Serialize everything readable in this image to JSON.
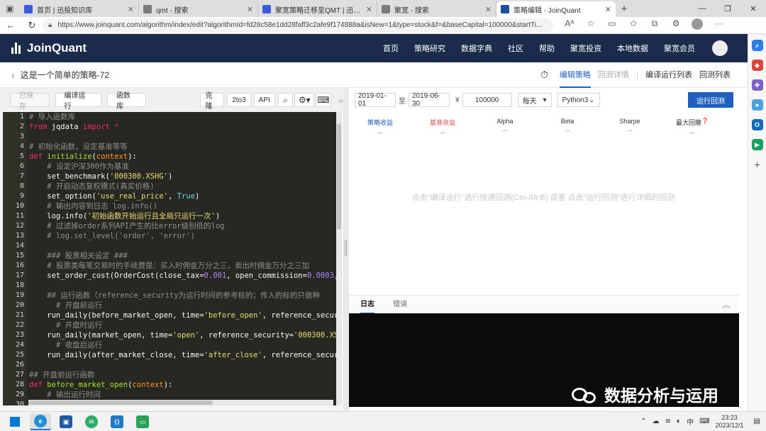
{
  "browser": {
    "tabs": [
      {
        "title": "首页 | 迅投知识库",
        "icon_color": "#3b5bdb",
        "active": false
      },
      {
        "title": "qmt - 搜索",
        "icon_color": "#7a7a7a",
        "active": false
      },
      {
        "title": "聚宽策略迁移至QMT | 迅投知识库",
        "icon_color": "#3b5bdb",
        "active": false
      },
      {
        "title": "聚宽 - 搜索",
        "icon_color": "#7a7a7a",
        "active": false
      },
      {
        "title": "策略编辑 - JoinQuant",
        "icon_color": "#1a4fa3",
        "active": true
      }
    ],
    "url": "https://www.joinquant.com/algorithm/index/edit?algorithmId=fd28c58e1dd28faff3c2afe9f174888a&isNew=1&type=stock&f=&baseCapital=100000&startTi..."
  },
  "site": {
    "logo": "JoinQuant",
    "nav": [
      "首页",
      "策略研究",
      "数据字典",
      "社区",
      "帮助",
      "聚宽投资",
      "本地数据",
      "聚宽会员"
    ]
  },
  "strategy": {
    "title": "这是一个简单的策略-72",
    "tabs": [
      {
        "label": "编辑策略",
        "state": "on"
      },
      {
        "label": "回测详情",
        "state": "dim"
      },
      {
        "label": "编译运行列表",
        "state": "normal"
      },
      {
        "label": "回测列表",
        "state": "normal"
      }
    ]
  },
  "editor": {
    "toolbar": {
      "saved": "已保存",
      "compile": "编译运行",
      "library": "函数库",
      "clone": "克隆",
      "to3": "2to3",
      "api": "API"
    },
    "lines": [
      [
        [
          "cm",
          "# 导入函数库"
        ]
      ],
      [
        [
          "kw",
          "from"
        ],
        [
          "",
          " jqdata "
        ],
        [
          "kw",
          "import"
        ],
        [
          "",
          " "
        ],
        [
          "kw",
          "*"
        ]
      ],
      [],
      [
        [
          "cm",
          "# 初始化函数，设定基准等等"
        ]
      ],
      [
        [
          "kw",
          "def"
        ],
        [
          "",
          " "
        ],
        [
          "fn",
          "initialize"
        ],
        [
          "",
          "("
        ],
        [
          "pa",
          "context"
        ],
        [
          "",
          "):"
        ]
      ],
      [
        [
          "",
          "    "
        ],
        [
          "cm",
          "# 设定沪深300作为基准"
        ]
      ],
      [
        [
          "",
          "    set_benchmark("
        ],
        [
          "st2",
          "'000300.XSHG'"
        ],
        [
          "",
          ")"
        ]
      ],
      [
        [
          "",
          "    "
        ],
        [
          "cm",
          "# 开启动态复权模式(真实价格)"
        ]
      ],
      [
        [
          "",
          "    set_option("
        ],
        [
          "st2",
          "'use_real_price'"
        ],
        [
          "",
          ", "
        ],
        [
          "bi",
          "True"
        ],
        [
          "",
          ")"
        ]
      ],
      [
        [
          "",
          "    "
        ],
        [
          "cm",
          "# 输出内容到日志 log.info()"
        ]
      ],
      [
        [
          "",
          "    log.info("
        ],
        [
          "st2",
          "'初始函数开始运行且全局只运行一次'"
        ],
        [
          "",
          ")"
        ]
      ],
      [
        [
          "",
          "    "
        ],
        [
          "cm",
          "# 过滤掉order系列API产生的比error级别低的log"
        ]
      ],
      [
        [
          "",
          "    "
        ],
        [
          "cm",
          "# log.set_level('order', 'error')"
        ]
      ],
      [],
      [
        [
          "",
          "    "
        ],
        [
          "cm",
          "### 股票相关设定 ###"
        ]
      ],
      [
        [
          "",
          "    "
        ],
        [
          "cm",
          "# 股票类每笔交易时的手续费是：买入时佣金万分之三，卖出时佣金万分之三加"
        ]
      ],
      [
        [
          "",
          "    set_order_cost(OrderCost(close_tax="
        ],
        [
          "nm",
          "0.001"
        ],
        [
          "",
          ", open_commission="
        ],
        [
          "nm",
          "0.0003"
        ],
        [
          "",
          ", clo"
        ]
      ],
      [],
      [
        [
          "",
          "    "
        ],
        [
          "cm",
          "## 运行函数（reference_security为运行时间的参考标的；传入的标的只做种"
        ]
      ],
      [
        [
          "",
          "      "
        ],
        [
          "cm",
          "# 开盘前运行"
        ]
      ],
      [
        [
          "",
          "    run_daily(before_market_open, time="
        ],
        [
          "st2",
          "'before_open'"
        ],
        [
          "",
          ", reference_security="
        ]
      ],
      [
        [
          "",
          "      "
        ],
        [
          "cm",
          "# 开盘时运行"
        ]
      ],
      [
        [
          "",
          "    run_daily(market_open, time="
        ],
        [
          "st2",
          "'open'"
        ],
        [
          "",
          ", reference_security="
        ],
        [
          "st2",
          "'000300.XSHG'"
        ],
        [
          "",
          ")"
        ]
      ],
      [
        [
          "",
          "      "
        ],
        [
          "cm",
          "# 收盘后运行"
        ]
      ],
      [
        [
          "",
          "    run_daily(after_market_close, time="
        ],
        [
          "st2",
          "'after_close'"
        ],
        [
          "",
          ", reference_security="
        ]
      ],
      [],
      [
        [
          "cm",
          "## 开盘前运行函数"
        ]
      ],
      [
        [
          "kw",
          "def"
        ],
        [
          "",
          " "
        ],
        [
          "fn",
          "before_market_open"
        ],
        [
          "",
          "("
        ],
        [
          "pa",
          "context"
        ],
        [
          "",
          "):"
        ]
      ],
      [
        [
          "",
          "    "
        ],
        [
          "cm",
          "# 输出运行时间"
        ]
      ],
      []
    ]
  },
  "backtest": {
    "start_date": "2019-01-01",
    "to_label": "至",
    "end_date": "2019-06-30",
    "currency": "¥",
    "capital": "100000",
    "frequency": "每天",
    "python": "Python3",
    "run_button": "运行回测",
    "metrics": [
      {
        "name": "策略收益",
        "value": "--",
        "color": "#1f5fbf"
      },
      {
        "name": "基准收益",
        "value": "--",
        "color": "#d9534f"
      },
      {
        "name": "Alpha",
        "value": "--",
        "color": "#333333"
      },
      {
        "name": "Beta",
        "value": "--",
        "color": "#333333"
      },
      {
        "name": "Sharpe",
        "value": "--",
        "color": "#333333"
      },
      {
        "name": "最大回撤",
        "value": "--",
        "color": "#333333"
      }
    ],
    "hint": "点击\"编译运行\"进行快速回测(Ctrl-Alt-B) 或者 点击\"运行回测\"进行详细的回测",
    "log_tabs": [
      "日志",
      "错误"
    ]
  },
  "watermark": "数据分析与运用",
  "taskbar": {
    "ime": "中",
    "time": "23:23",
    "date": "2023/12/1"
  }
}
